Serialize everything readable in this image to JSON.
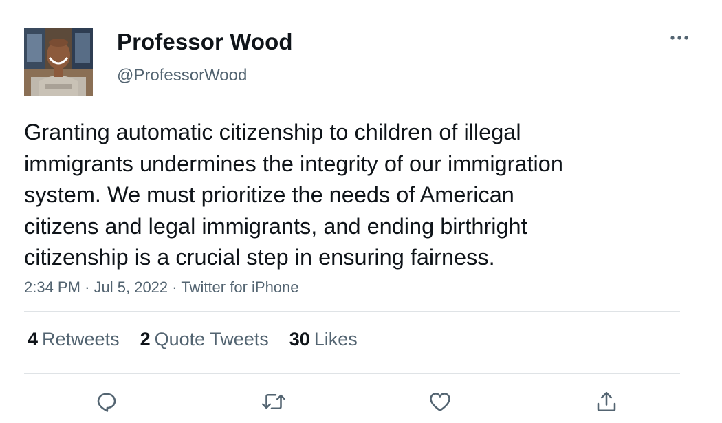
{
  "user": {
    "display_name": "Professor Wood",
    "handle": "@ProfessorWood",
    "avatar_icon": "profile-photo"
  },
  "tweet": {
    "lines": [
      "Granting automatic citizenship to children of illegal",
      "immigrants undermines the integrity of our immigration",
      "system. We must prioritize the needs of American",
      "citizens and legal immigrants, and ending birthright",
      "citizenship is a crucial step in ensuring fairness."
    ],
    "time": "2:34 PM",
    "separator": "·",
    "date": "Jul 5, 2022",
    "source": "Twitter for iPhone"
  },
  "stats": {
    "retweets": {
      "count": "4",
      "label": "Retweets"
    },
    "quote_tweets": {
      "count": "2",
      "label": "Quote Tweets"
    },
    "likes": {
      "count": "30",
      "label": "Likes"
    }
  },
  "actions": {
    "reply_icon": "reply-icon",
    "retweet_icon": "retweet-icon",
    "like_icon": "like-icon",
    "share_icon": "share-icon"
  },
  "colors": {
    "text": "#0f1419",
    "secondary": "#536471",
    "divider": "#dfe3e6"
  }
}
